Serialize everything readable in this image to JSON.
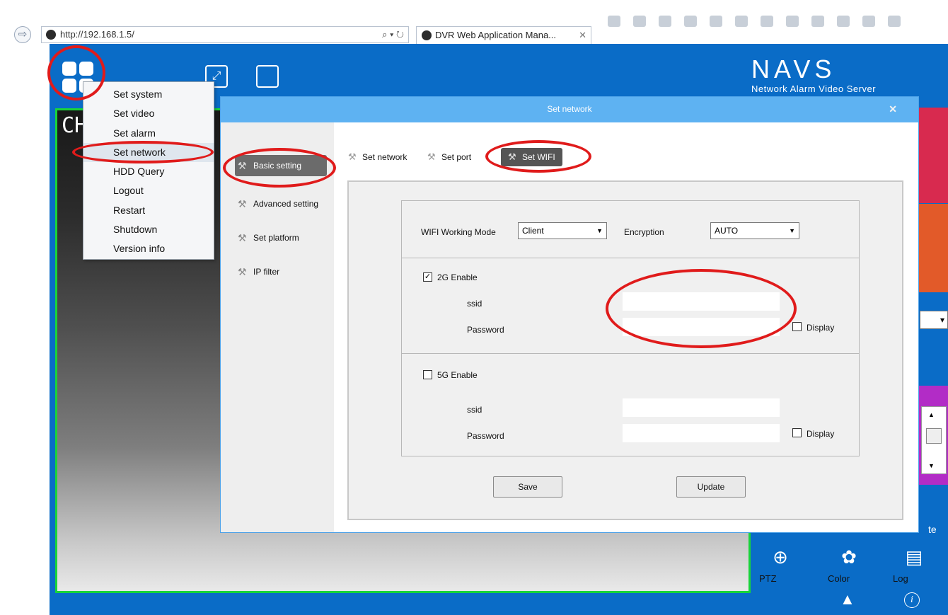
{
  "browser": {
    "url": "http://192.168.1.5/",
    "url_tools": "⌕ ▾ ↻",
    "tab_title": "DVR Web Application Mana...",
    "tab_close": "✕"
  },
  "app": {
    "brand_title": "NAVS",
    "brand_subtitle": "Network Alarm Video Server",
    "video_label": "CH",
    "side_text": "te"
  },
  "system_menu": {
    "items": [
      "Set system",
      "Set video",
      "Set alarm",
      "Set network",
      "HDD Query",
      "Logout",
      "Restart",
      "Shutdown",
      "Version info"
    ]
  },
  "bottom_tools": {
    "ptz_label": "PTZ",
    "color_label": "Color",
    "log_label": "Log"
  },
  "dialog": {
    "title": "Set network",
    "close": "✕",
    "nav": [
      "Basic setting",
      "Advanced setting",
      "Set platform",
      "IP filter"
    ],
    "tabs": [
      "Set network",
      "Set port",
      "Set WIFI"
    ],
    "wifi_mode_label": "WIFI Working Mode",
    "wifi_mode_value": "Client",
    "encryption_label": "Encryption",
    "encryption_value": "AUTO",
    "enable_2g_label": "2G Enable",
    "enable_5g_label": "5G Enable",
    "ssid_label": "ssid",
    "password_label": "Password",
    "display_label": "Display",
    "ssid_2g": "",
    "password_2g": "",
    "ssid_5g": "",
    "password_5g": "",
    "save_label": "Save",
    "update_label": "Update"
  },
  "colors": {
    "app_blue": "#0a6cc7",
    "titlebar": "#5eb2f2",
    "annotation": "#e01b1b",
    "video_border": "#19d43a"
  }
}
